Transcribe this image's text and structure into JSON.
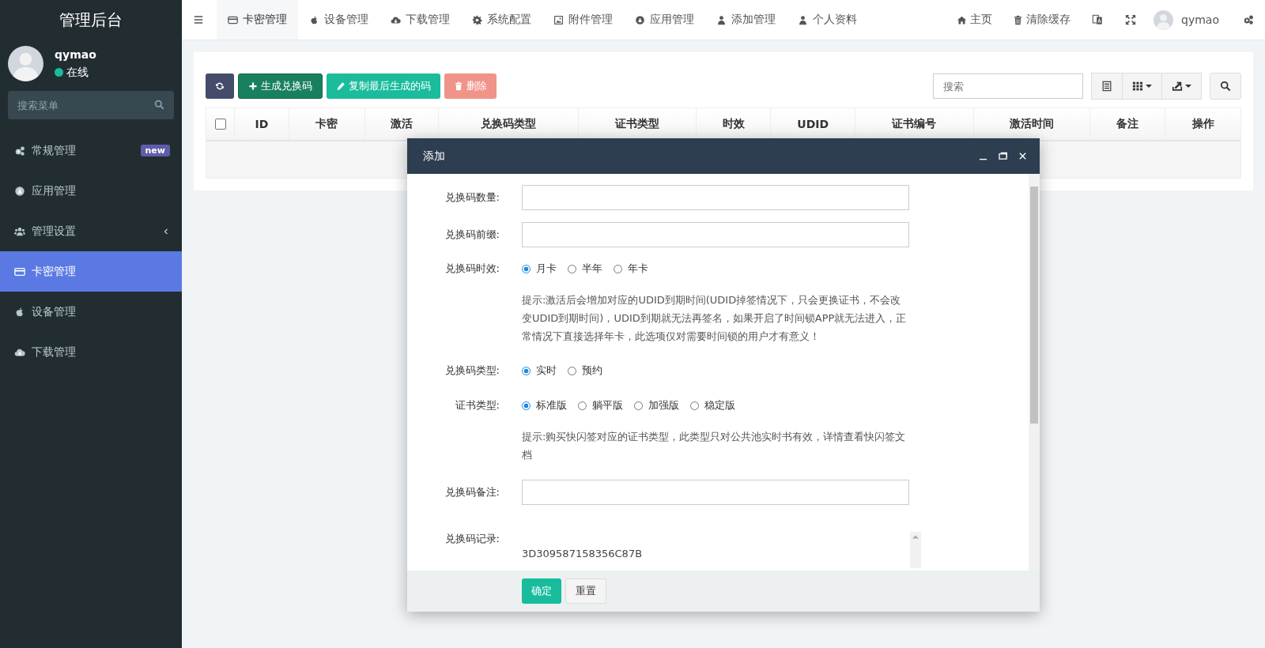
{
  "sidebar": {
    "title": "管理后台",
    "user": {
      "name": "qymao",
      "status": "在线",
      "online": true
    },
    "search": {
      "placeholder": "搜索菜单"
    },
    "items": [
      {
        "label": "常规管理",
        "kind": "gears",
        "badge": "new",
        "expandable": false,
        "selected": false
      },
      {
        "label": "应用管理",
        "kind": "circle",
        "expandable": false,
        "selected": false
      },
      {
        "label": "管理设置",
        "kind": "users",
        "expandable": true,
        "selected": false
      },
      {
        "label": "卡密管理",
        "kind": "card",
        "expandable": false,
        "selected": true
      },
      {
        "label": "设备管理",
        "kind": "apple",
        "expandable": false,
        "selected": false
      },
      {
        "label": "下载管理",
        "kind": "cloud",
        "expandable": false,
        "selected": false
      }
    ]
  },
  "topnav": {
    "tabs": [
      {
        "label": "卡密管理",
        "kind": "card",
        "selected": true
      },
      {
        "label": "设备管理",
        "kind": "apple",
        "selected": false
      },
      {
        "label": "下载管理",
        "kind": "cloud",
        "selected": false
      },
      {
        "label": "系统配置",
        "kind": "gear",
        "selected": false
      },
      {
        "label": "附件管理",
        "kind": "image",
        "selected": false
      },
      {
        "label": "应用管理",
        "kind": "circle",
        "selected": false
      },
      {
        "label": "添加管理",
        "kind": "user",
        "selected": false
      },
      {
        "label": "个人资料",
        "kind": "user",
        "selected": false
      }
    ],
    "actions": [
      {
        "label": "主页",
        "kind": "home"
      },
      {
        "label": "清除缓存",
        "kind": "trash"
      },
      {
        "kind": "translate"
      },
      {
        "kind": "expand"
      }
    ],
    "user": "qymao"
  },
  "toolbar": {
    "buttons": [
      {
        "kind": "refresh",
        "disabled": false
      },
      {
        "kind": "add",
        "label": "生成兑换码",
        "disabled": false
      },
      {
        "kind": "copy",
        "label": "复制最后生成的码",
        "disabled": false
      },
      {
        "kind": "delete",
        "label": "删除",
        "disabled": true
      }
    ],
    "search": {
      "placeholder": "搜索"
    }
  },
  "table": {
    "select_all": {
      "checked": false
    },
    "columns": [
      "ID",
      "卡密",
      "激活",
      "兑换码类型",
      "证书类型",
      "时效",
      "UDID",
      "证书编号",
      "激活时间",
      "备注",
      "操作"
    ]
  },
  "dialog": {
    "title": "添加",
    "fields": [
      {
        "kind": "input",
        "label": "兑换码数量:"
      },
      {
        "kind": "input",
        "label": "兑换码前缀:"
      },
      {
        "kind": "radio",
        "label": "兑换码时效:",
        "options": [
          {
            "label": "月卡",
            "selected": true
          },
          {
            "label": "半年",
            "selected": false
          },
          {
            "label": "年卡",
            "selected": false
          }
        ]
      },
      {
        "kind": "hint",
        "text": "提示:激活后会增加对应的UDID到期时间(UDID掉签情况下，只会更换证书，不会改变UDID到期时间)，UDID到期就无法再签名，如果开启了时间锁APP就无法进入，正常情况下直接选择年卡，此选项仅对需要时间锁的用户才有意义！"
      },
      {
        "kind": "radio",
        "label": "兑换码类型:",
        "options": [
          {
            "label": "实时",
            "selected": true
          },
          {
            "label": "预约",
            "selected": false
          }
        ]
      },
      {
        "kind": "radio",
        "label": "证书类型:",
        "options": [
          {
            "label": "标准版",
            "selected": true
          },
          {
            "label": "躺平版",
            "selected": false
          },
          {
            "label": "加强版",
            "selected": false
          },
          {
            "label": "稳定版",
            "selected": false
          }
        ]
      },
      {
        "kind": "hint",
        "text": "提示:购买快闪签对应的证书类型，此类型只对公共池实时书有效，详情查看快闪签文档"
      },
      {
        "kind": "input",
        "label": "兑换码备注:"
      },
      {
        "kind": "textarea",
        "label": "兑换码记录:",
        "value": "3D309587158356C87B"
      }
    ],
    "buttons": [
      {
        "kind": "primary",
        "label": "确定"
      },
      {
        "kind": "default",
        "label": "重置"
      }
    ]
  }
}
